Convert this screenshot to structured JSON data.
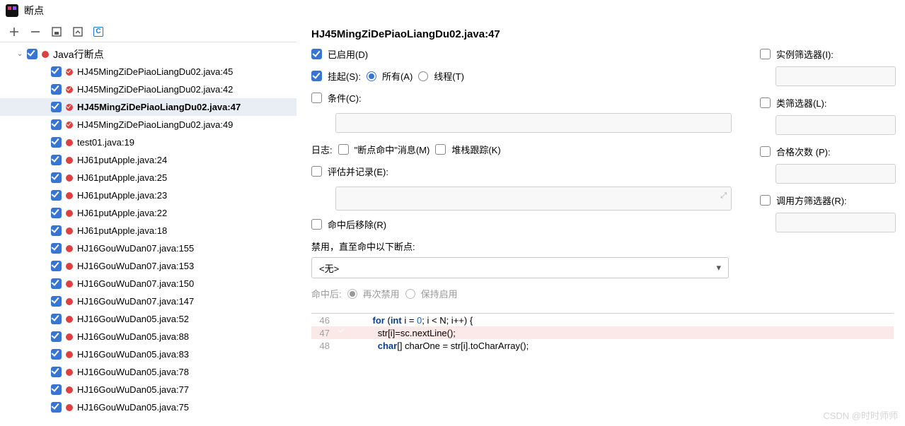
{
  "window": {
    "title": "断点"
  },
  "tree": {
    "root_label": "Java行断点",
    "items": [
      {
        "label": "HJ45MingZiDePiaoLiangDu02.java:45",
        "dot": "check"
      },
      {
        "label": "HJ45MingZiDePiaoLiangDu02.java:42",
        "dot": "check"
      },
      {
        "label": "HJ45MingZiDePiaoLiangDu02.java:47",
        "dot": "check",
        "selected": true
      },
      {
        "label": "HJ45MingZiDePiaoLiangDu02.java:49",
        "dot": "check"
      },
      {
        "label": "test01.java:19",
        "dot": "plain"
      },
      {
        "label": "HJ61putApple.java:24",
        "dot": "plain"
      },
      {
        "label": "HJ61putApple.java:25",
        "dot": "plain"
      },
      {
        "label": "HJ61putApple.java:23",
        "dot": "plain"
      },
      {
        "label": "HJ61putApple.java:22",
        "dot": "plain"
      },
      {
        "label": "HJ61putApple.java:18",
        "dot": "plain"
      },
      {
        "label": "HJ16GouWuDan07.java:155",
        "dot": "plain"
      },
      {
        "label": "HJ16GouWuDan07.java:153",
        "dot": "plain"
      },
      {
        "label": "HJ16GouWuDan07.java:150",
        "dot": "plain"
      },
      {
        "label": "HJ16GouWuDan07.java:147",
        "dot": "plain"
      },
      {
        "label": "HJ16GouWuDan05.java:52",
        "dot": "plain"
      },
      {
        "label": "HJ16GouWuDan05.java:88",
        "dot": "plain"
      },
      {
        "label": "HJ16GouWuDan05.java:83",
        "dot": "plain"
      },
      {
        "label": "HJ16GouWuDan05.java:78",
        "dot": "plain"
      },
      {
        "label": "HJ16GouWuDan05.java:77",
        "dot": "plain"
      },
      {
        "label": "HJ16GouWuDan05.java:75",
        "dot": "plain"
      }
    ]
  },
  "details": {
    "title": "HJ45MingZiDePiaoLiangDu02.java:47",
    "enabled": "已启用(D)",
    "suspend": "挂起(S):",
    "all": "所有(A)",
    "thread": "线程(T)",
    "condition": "条件(C):",
    "log_label": "日志:",
    "log_msg": "\"断点命中\"消息(M)",
    "stack": "堆栈跟踪(K)",
    "eval": "评估并记录(E):",
    "remove_hit": "命中后移除(R)",
    "disable_until": "禁用，直至命中以下断点:",
    "select_none": "<无>",
    "after_hit": "命中后:",
    "redisable": "再次禁用",
    "keep_enabled": "保持启用",
    "instance_filter": "实例筛选器(I):",
    "class_filter": "类筛选器(L):",
    "pass_count": "合格次数 (P):",
    "caller_filter": "调用方筛选器(R):"
  },
  "code": {
    "ln1": "46",
    "ln2": "47",
    "ln3": "48",
    "l1a": "for",
    "l1b": " (",
    "l1c": "int",
    "l1d": " i = ",
    "l1e": "0",
    "l1f": "; i < N; i++) {",
    "l2": "    str[i]=sc.nextLine();",
    "l3a": "char",
    "l3b": "[] charOne = str[i].toCharArray();"
  },
  "watermark": "CSDN @时时师师"
}
